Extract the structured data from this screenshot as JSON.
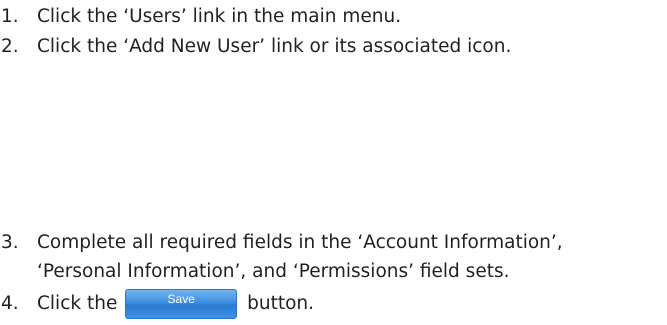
{
  "steps": [
    {
      "number": "1.",
      "text": "Click the ‘Users’ link in the main menu."
    },
    {
      "number": "2.",
      "text": "Click the ‘Add New User’ link or its associated icon."
    },
    {
      "number": "3.",
      "text": "Complete all required fields in the ‘Account Information’,",
      "text_line2": "‘Personal Information’, and ‘Permissions’ field sets."
    },
    {
      "number": "4.",
      "text_before": "Click the",
      "button_label": "Save",
      "text_after": "button."
    }
  ]
}
